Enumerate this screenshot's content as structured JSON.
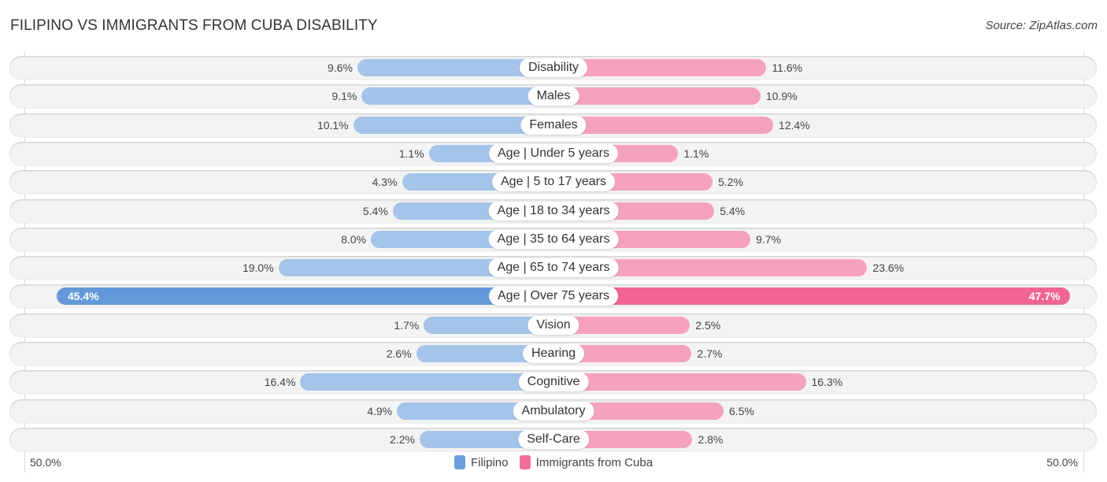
{
  "header": {
    "title": "FILIPINO VS IMMIGRANTS FROM CUBA DISABILITY",
    "source": "Source: ZipAtlas.com"
  },
  "axis": {
    "left_label": "50.0%",
    "right_label": "50.0%"
  },
  "legend": [
    {
      "label": "Filipino",
      "color": "#6a9fdc"
    },
    {
      "label": "Immigrants from Cuba",
      "color": "#f06e98"
    }
  ],
  "colors": {
    "filipino_light": "#a4c4e9",
    "filipino_strong": "#6399d8",
    "cuba_light": "#f5a3bd",
    "cuba_strong": "#f06592"
  },
  "chart_data": {
    "type": "bar",
    "orientation": "horizontal-diverging",
    "title": "FILIPINO VS IMMIGRANTS FROM CUBA DISABILITY",
    "xlabel": "",
    "ylabel": "",
    "xlim": [
      -50,
      50
    ],
    "categories": [
      "Disability",
      "Males",
      "Females",
      "Age | Under 5 years",
      "Age | 5 to 17 years",
      "Age | 18 to 34 years",
      "Age | 35 to 64 years",
      "Age | 65 to 74 years",
      "Age | Over 75 years",
      "Vision",
      "Hearing",
      "Cognitive",
      "Ambulatory",
      "Self-Care"
    ],
    "series": [
      {
        "name": "Filipino",
        "values": [
          9.6,
          9.1,
          10.1,
          1.1,
          4.3,
          5.4,
          8.0,
          19.0,
          45.4,
          1.7,
          2.6,
          16.4,
          4.9,
          2.2
        ],
        "labels": [
          "9.6%",
          "9.1%",
          "10.1%",
          "1.1%",
          "4.3%",
          "5.4%",
          "8.0%",
          "19.0%",
          "45.4%",
          "1.7%",
          "2.6%",
          "16.4%",
          "4.9%",
          "2.2%"
        ]
      },
      {
        "name": "Immigrants from Cuba",
        "values": [
          11.6,
          10.9,
          12.4,
          1.1,
          5.2,
          5.4,
          9.7,
          23.6,
          47.7,
          2.5,
          2.7,
          16.3,
          6.5,
          2.8
        ],
        "labels": [
          "11.6%",
          "10.9%",
          "12.4%",
          "1.1%",
          "5.2%",
          "5.4%",
          "9.7%",
          "23.6%",
          "47.7%",
          "2.5%",
          "2.7%",
          "16.3%",
          "6.5%",
          "2.8%"
        ]
      }
    ],
    "legend_position": "bottom-center",
    "grid": false
  }
}
